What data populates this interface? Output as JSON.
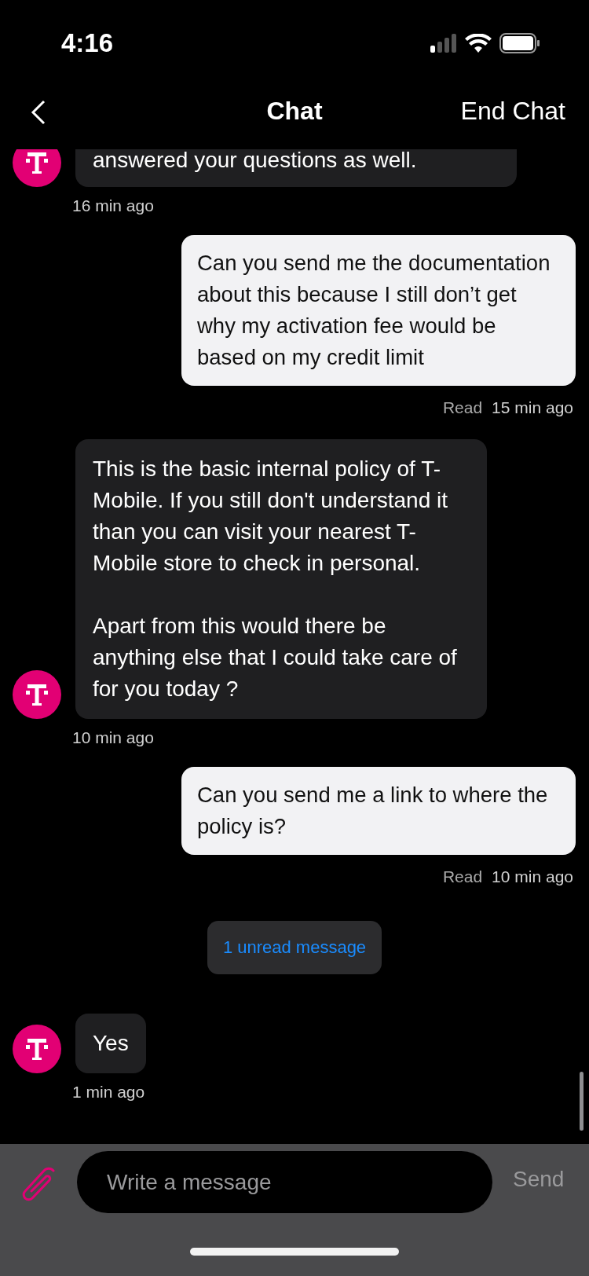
{
  "status_bar": {
    "time": "4:16"
  },
  "header": {
    "title": "Chat",
    "action": "End Chat"
  },
  "messages": [
    {
      "kind": "agent",
      "text": "answered your questions as well.",
      "time": "16 min ago",
      "avatar": true
    },
    {
      "kind": "user",
      "text": "Can you send me the documentation about this because I still don’t get why my activation fee would be based on my credit limit",
      "status": "Read",
      "time": "15 min ago"
    },
    {
      "kind": "agent",
      "text": "This is the basic internal policy of T-Mobile. If you still don't understand it than you can visit your nearest T-Mobile store to check in personal.\n\nApart from this would there be anything else that I could take care of for you today ?",
      "time": "10 min ago",
      "avatar": true
    },
    {
      "kind": "user",
      "text": "Can you send me a link to where the policy is?",
      "status": "Read",
      "time": "10 min ago"
    },
    {
      "kind": "notice",
      "text": "1 unread message"
    },
    {
      "kind": "agent",
      "text": "Yes",
      "time": "1 min ago",
      "avatar": true
    }
  ],
  "composer": {
    "placeholder": "Write a message",
    "send": "Send"
  }
}
